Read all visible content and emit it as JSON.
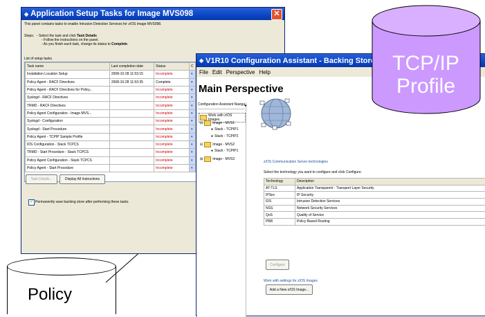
{
  "setup_window": {
    "title": "Application Setup Tasks for Image MVS098",
    "close_glyph": "✕",
    "intro": "This panel contains tasks to enable Intrusion Detection Services for z/OS image MVS098.",
    "steps_label": "Steps:",
    "step1_prefix": "- Select the task and click",
    "step1_bold": "Task Details",
    "step2": "- Follow the instructions on the panel.",
    "step3_prefix": "- As you finish each task, change its status to",
    "step3_bold": "Complete",
    "list_label": "List of setup tasks",
    "columns": [
      "Task name",
      "Last completion date",
      "Status",
      "C"
    ],
    "tasks": [
      {
        "name": "Installation Location Setup",
        "date": "2008-10-28 11:53:15",
        "status": "Incomplete"
      },
      {
        "name": "Policy Agent - RACF Directives",
        "date": "2008-10-28 11:53:35",
        "status": "Complete"
      },
      {
        "name": "Policy Agent - RACF Directives for Policy...",
        "date": "",
        "status": "Incomplete"
      },
      {
        "name": "Syslogd - RACF Directives",
        "date": "",
        "status": "Incomplete"
      },
      {
        "name": "TRMD - RACF Directives",
        "date": "",
        "status": "Incomplete"
      },
      {
        "name": "Policy Agent Configuration - Image MVS...",
        "date": "",
        "status": "Incomplete"
      },
      {
        "name": "Syslogd - Configuration",
        "date": "",
        "status": "Incomplete"
      },
      {
        "name": "Syslogd - Start Procedure",
        "date": "",
        "status": "Incomplete"
      },
      {
        "name": "Policy Agent - TCPIP Sample Profile",
        "date": "",
        "status": "Incomplete"
      },
      {
        "name": "IDS Configuration - Stack TCPCS",
        "date": "",
        "status": "Incomplete"
      },
      {
        "name": "TRMD - Start Procedure - Stack TCPCS",
        "date": "",
        "status": "Incomplete"
      },
      {
        "name": "Policy Agent Configuration - Stack TCPCS",
        "date": "",
        "status": "Incomplete"
      },
      {
        "name": "Policy Agent - Start Procedure",
        "date": "",
        "status": "Incomplete"
      }
    ],
    "dropdown_glyph": "▾",
    "task_details_button": "Task Details...",
    "display_all_button": "Display All Instructions",
    "checkbox_label": "Permanently save backing store after performing these tasks",
    "checkbox_glyph": "✓"
  },
  "config_window": {
    "title": "V1R10 Configuration Assistant - Backing Store (Read-Writ",
    "menu": [
      "File",
      "Edit",
      "Perspective",
      "Help"
    ],
    "perspective_title": "Main Perspective",
    "nav_header": "Configuration Assistant Navigation",
    "tree": {
      "root": "Work with z/OS Images",
      "image1": "Image - MVS1",
      "stack1": "Stack - TCPIP1",
      "stack2": "Stack - TCPIP2",
      "image2": "Image - MVS2",
      "stack3": "Stack - TCPIP1",
      "image3": "Image - MVS3"
    },
    "comm_group_label": "z/OS Communication Server technologies",
    "select_instruction": "Select the technology you want to configure and click Configure.",
    "tech_columns": [
      "Technology",
      "Description"
    ],
    "tech_rows": [
      {
        "tech": "AT-TLS",
        "desc": "Application Transparent - Transport Layer Security"
      },
      {
        "tech": "IPSec",
        "desc": "IP Security"
      },
      {
        "tech": "IDS",
        "desc": "Intrusion Detection Services"
      },
      {
        "tech": "NSS",
        "desc": "Network Security Services"
      },
      {
        "tech": "QoS",
        "desc": "Quality of Service"
      },
      {
        "tech": "PBR",
        "desc": "Policy Based Routing"
      }
    ],
    "configure_button": "Configure",
    "settings_group_label": "Work with settings for z/OS Images",
    "add_image_button": "Add a New z/OS Image..."
  },
  "tcpip_cylinder": {
    "line1": "TCP/IP",
    "line2": "Profile",
    "fill": "#cc99ff"
  },
  "policy_cylinder": {
    "label": "Policy"
  },
  "colors": {
    "title_bar": "#0a46c6",
    "incomplete": "#d0000a",
    "window_bg": "#ece9d8"
  }
}
